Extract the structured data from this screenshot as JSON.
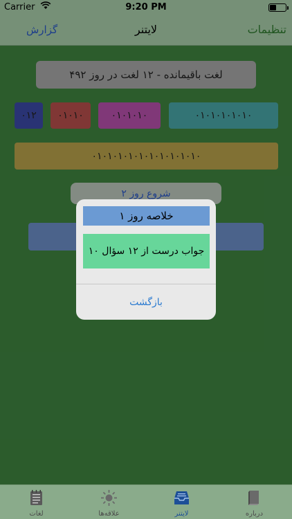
{
  "status_bar": {
    "carrier": "Carrier",
    "time": "9:20 PM"
  },
  "nav": {
    "left_button": "گزارش",
    "title": "لایتنر",
    "right_button": "تنظیمات"
  },
  "main": {
    "summary": "۴۹۲ لغت باقیمانده - ۱۲ لغت در روز",
    "boxes": [
      "۰۱۲",
      "۰۱۰۱۰",
      "۰۱۰۱۰۱۰",
      "۰۱۰۱۰۱۰۱۰۱۰",
      "۰۱۰۱۰۱۰۱۰۱۰۱۰۱۰۱۰۱۰۱۰"
    ],
    "start_button": "شروع روز ۲"
  },
  "alert": {
    "title": "خلاصه روز ۱",
    "message": "۱۰ جواب درست از ۱۲ سؤال",
    "button": "بازگشت"
  },
  "tabs": [
    {
      "label": "لغات",
      "icon": "notebook-icon"
    },
    {
      "label": "علاقه‌ها",
      "icon": "sun-icon"
    },
    {
      "label": "لایتنر",
      "icon": "inbox-tray-icon",
      "active": true
    },
    {
      "label": "درباره",
      "icon": "book-icon"
    }
  ]
}
